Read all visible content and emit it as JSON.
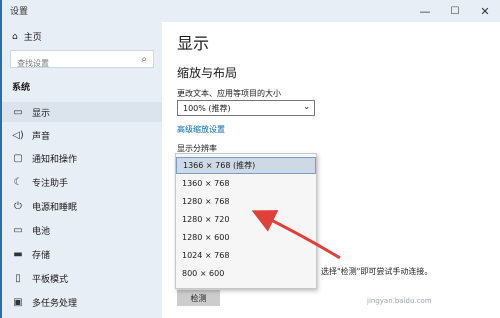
{
  "window": {
    "title": "设置",
    "minimize": "—",
    "maximize": "☐",
    "close": "✕"
  },
  "sidebar": {
    "home": {
      "icon": "home-icon",
      "label": "主页"
    },
    "search": {
      "placeholder": "查找设置",
      "icon": "search-icon"
    },
    "section": "系统",
    "items": [
      {
        "icon": "monitor-icon",
        "label": "显示",
        "selected": true
      },
      {
        "icon": "speaker-icon",
        "label": "声音"
      },
      {
        "icon": "notification-icon",
        "label": "通知和操作"
      },
      {
        "icon": "moon-icon",
        "label": "专注助手"
      },
      {
        "icon": "power-icon",
        "label": "电源和睡眠"
      },
      {
        "icon": "battery-icon",
        "label": "电池"
      },
      {
        "icon": "storage-icon",
        "label": "存储"
      },
      {
        "icon": "tablet-icon",
        "label": "平板模式"
      },
      {
        "icon": "multitask-icon",
        "label": "多任务处理"
      }
    ]
  },
  "main": {
    "title": "显示",
    "section_title": "缩放与布局",
    "scale_label": "更改文本、应用等项目的大小",
    "scale_value": "100% (推荐)",
    "advanced_link": "高级缩放设置",
    "resolution_label": "显示分辨率",
    "resolution_options": [
      "1366 × 768 (推荐)",
      "1360 × 768",
      "1280 × 768",
      "1280 × 720",
      "1280 × 600",
      "1024 × 768",
      "800 × 600"
    ],
    "selected_option_index": 0,
    "description": "一些旧式显示器可能不会进行自动连接。选择\"检测\"即可尝试手动连接。",
    "detect_button": "检测"
  },
  "annotation": {
    "color": "#e0403a"
  },
  "watermark": "jingyan.baidu.com"
}
